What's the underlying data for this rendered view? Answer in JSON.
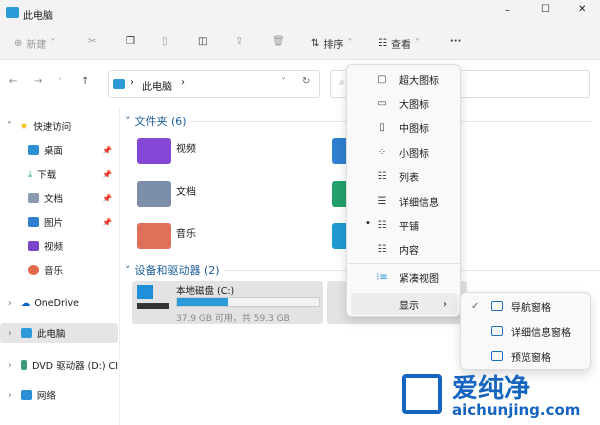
{
  "window": {
    "title": "此电脑",
    "minimize": "–",
    "maximize": "☐",
    "close": "✕"
  },
  "toolbar": {
    "new": "新建",
    "sort": "排序",
    "view": "查看",
    "more": "···"
  },
  "address": {
    "path": "此电脑",
    "sep": "›"
  },
  "nav": {
    "quick_access": "快速访问",
    "items": [
      {
        "label": "桌面",
        "color": "#2b8fd6"
      },
      {
        "label": "下载",
        "color": "#2aa876"
      },
      {
        "label": "文档",
        "color": "#8a9ab0"
      },
      {
        "label": "图片",
        "color": "#2f7fd0"
      },
      {
        "label": "视频",
        "color": "#7a45c8"
      },
      {
        "label": "音乐",
        "color": "#e26a4a"
      }
    ],
    "onedrive": "OneDrive",
    "this_pc": "此电脑",
    "dvd": "DVD 驱动器 (D:) CI",
    "network": "网络"
  },
  "content": {
    "folders_header": "文件夹 (6)",
    "folders": [
      {
        "label": "视频",
        "color": "#8646d6"
      },
      {
        "label": "文档",
        "color": "#7d8fa8"
      },
      {
        "label": "音乐",
        "color": "#e0705a"
      }
    ],
    "devices_header": "设备和驱动器 (2)",
    "drive_c": {
      "name": "本地磁盘 (C:)",
      "free": "37.9 GB 可用，共 59.3 GB",
      "used_fraction": 0.36
    }
  },
  "view_menu": {
    "items": [
      {
        "icon": "▢",
        "label": "超大图标"
      },
      {
        "icon": "▭",
        "label": "大图标"
      },
      {
        "icon": "▯",
        "label": "中图标"
      },
      {
        "icon": "⁘",
        "label": "小图标"
      },
      {
        "icon": "☷",
        "label": "列表"
      },
      {
        "icon": "☰",
        "label": "详细信息"
      },
      {
        "icon": "☷",
        "label": "平铺",
        "selected": "•"
      },
      {
        "icon": "☷",
        "label": "内容"
      }
    ],
    "compact": "紧凑视图",
    "show": "显示",
    "arrow": "›"
  },
  "show_submenu": {
    "items": [
      {
        "label": "导航窗格",
        "check": "✓"
      },
      {
        "label": "详细信息窗格"
      },
      {
        "label": "预览窗格"
      }
    ]
  },
  "watermark": {
    "text": "爱纯净",
    "url": "aichunjing.com"
  }
}
